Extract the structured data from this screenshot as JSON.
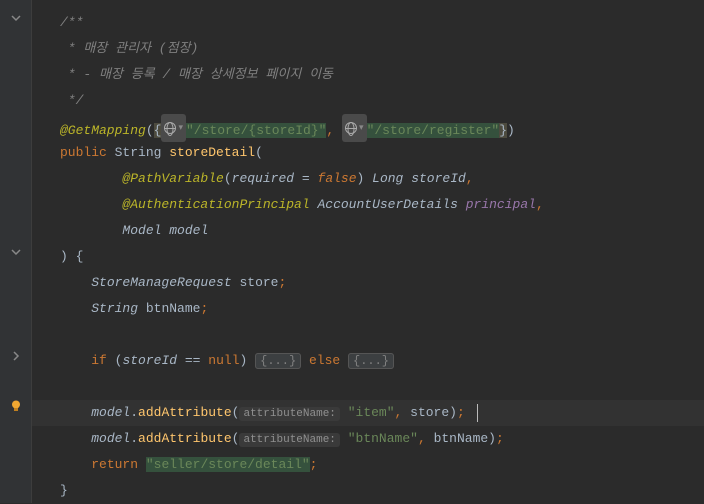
{
  "code": {
    "c1": "/**",
    "c2": " * 매장 관리자 (점장)",
    "c3": " * - 매장 등록 / 매장 상세정보 페이지 이동",
    "c4": " */",
    "getMapping": "@GetMapping",
    "url1": "\"/store/{storeId}\"",
    "url2": "\"/store/register\"",
    "public": "public",
    "stringType": "String",
    "methodName": "storeDetail",
    "pathVariable": "@PathVariable",
    "required": "required",
    "falseVal": "false",
    "longType": "Long",
    "storeId": "storeId",
    "authPrincipal": "@AuthenticationPrincipal",
    "accountUserDetails": "AccountUserDetails",
    "principal": "principal",
    "modelType": "Model",
    "modelVar": "model",
    "storeManageRequest": "StoreManageRequest",
    "store": "store",
    "btnName": "btnName",
    "ifKw": "if",
    "nullKw": "null",
    "elseKw": "else",
    "fold": "{...}",
    "addAttribute": "addAttribute",
    "attrName": "attributeName:",
    "itemStr": "\"item\"",
    "btnNameStr": "\"btnName\"",
    "returnKw": "return",
    "returnStr": "\"seller/store/detail\""
  }
}
